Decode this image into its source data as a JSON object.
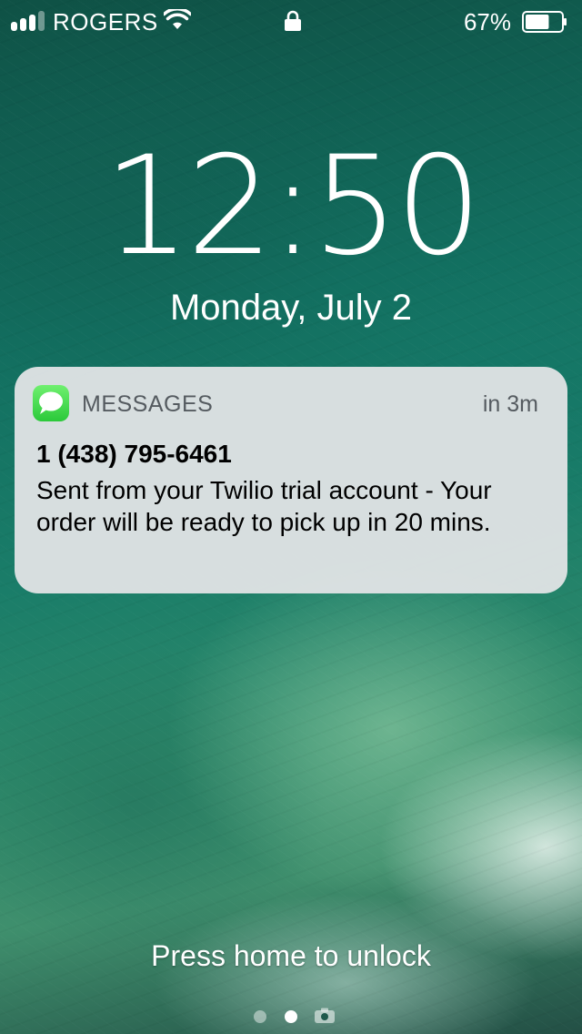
{
  "status_bar": {
    "carrier": "ROGERS",
    "battery_percent": "67%",
    "battery_level": 0.67,
    "signal_bars_filled": 3,
    "signal_bars_total": 4
  },
  "lock_screen": {
    "time": "12:50",
    "date": "Monday, July 2",
    "unlock_hint": "Press home to unlock"
  },
  "notification": {
    "app_name": "MESSAGES",
    "time_ago": "in 3m",
    "title": "1 (438) 795-6461",
    "body": "Sent from your Twilio trial account - Your order will be ready to pick up in 20 mins.",
    "app_icon": "messages-app-icon",
    "accent_color": "#34c759"
  },
  "page_indicator": {
    "pages": 2,
    "active_page": 2,
    "trailing_icon": "camera-icon"
  }
}
